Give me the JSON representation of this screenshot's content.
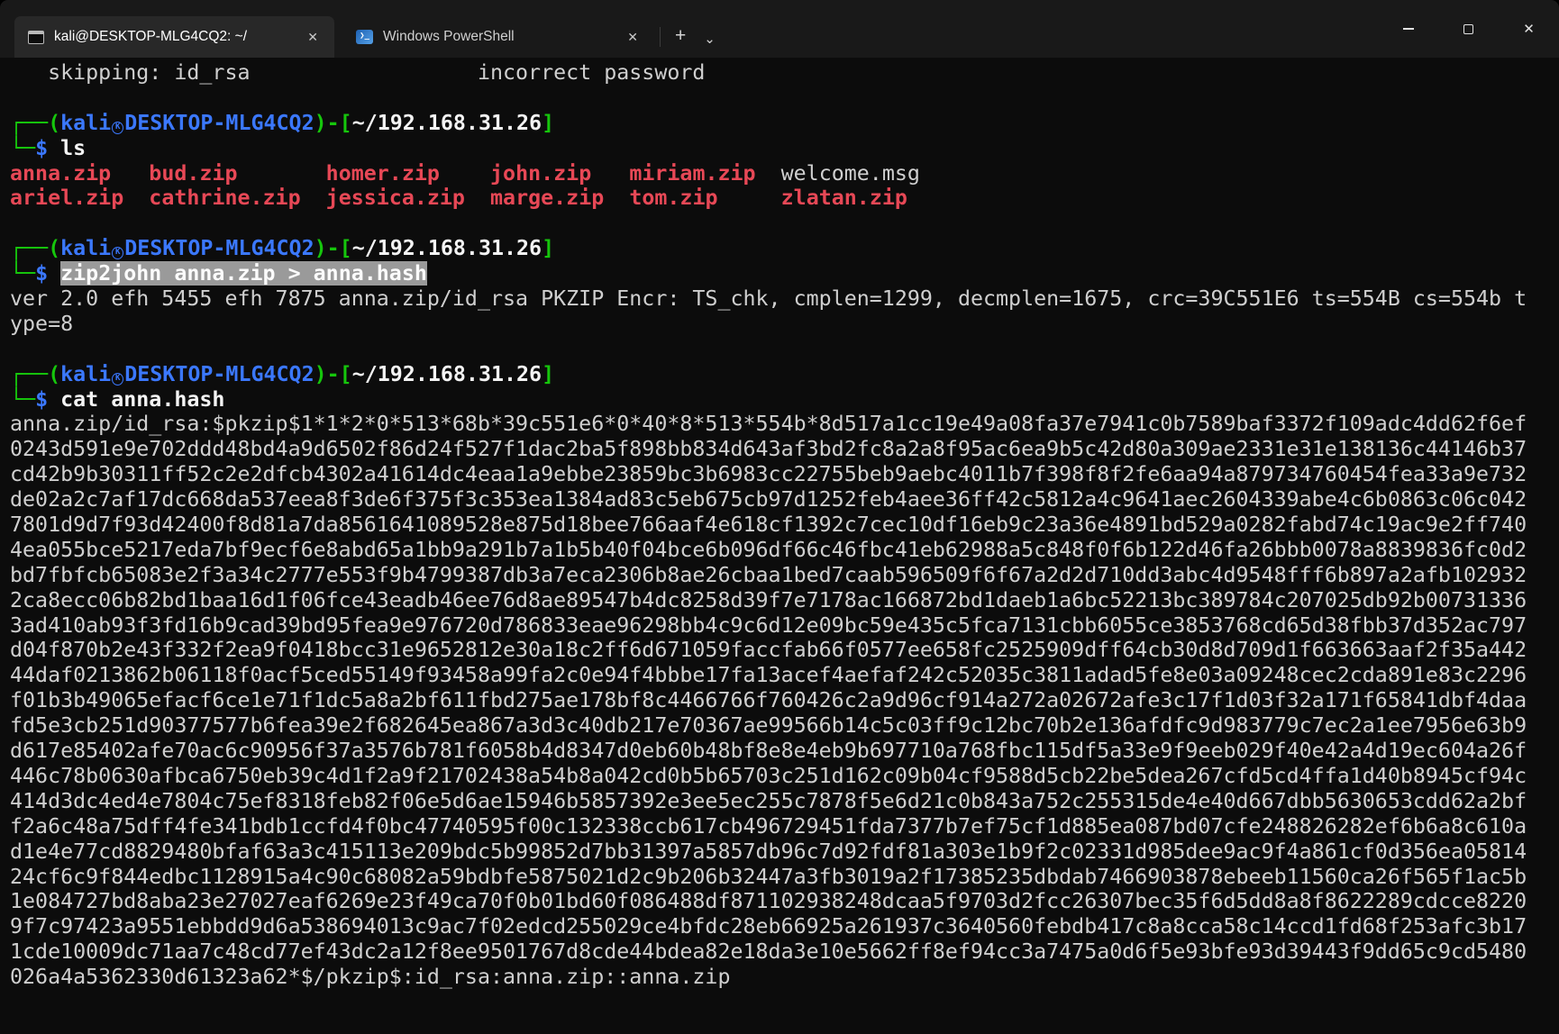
{
  "window": {
    "titlebar": {
      "tabs": [
        {
          "label": "kali@DESKTOP-MLG4CQ2: ~/",
          "icon": "terminal-icon",
          "active": true
        },
        {
          "label": "Windows PowerShell",
          "icon": "powershell-icon",
          "active": false
        }
      ],
      "icons": {
        "tab_close": "✕",
        "new_tab": "+",
        "dropdown": "⌄",
        "powershell_glyph": "❯_",
        "window_close": "✕"
      }
    }
  },
  "colors": {
    "terminal_background": "#0c0c0c",
    "titlebar_background": "#191919",
    "active_tab": "#282828",
    "foreground": "#cccccc",
    "prompt_green": "#16C60C",
    "prompt_blue": "#3B78FF",
    "file_red": "#E74856",
    "selection_background": "#9a9a9a"
  },
  "terminal": {
    "lines": [
      [
        {
          "t": "   skipping: id_rsa                  incorrect password",
          "c": "w"
        }
      ],
      [],
      [
        {
          "t": "┌──(",
          "c": "g"
        },
        {
          "t": "kali",
          "c": "b"
        },
        {
          "t": "㉿",
          "c": "kglyph"
        },
        {
          "t": "DESKTOP-MLG4CQ2",
          "c": "b"
        },
        {
          "t": ")-[",
          "c": "g"
        },
        {
          "t": "~/192.168.31.26",
          "c": "wb"
        },
        {
          "t": "]",
          "c": "g"
        }
      ],
      [
        {
          "t": "└─",
          "c": "g"
        },
        {
          "t": "$",
          "c": "b"
        },
        {
          "t": " ls",
          "c": "wb"
        }
      ],
      [
        {
          "t": "anna.zip",
          "c": "r"
        },
        {
          "t": "   ",
          "c": "w"
        },
        {
          "t": "bud.zip",
          "c": "r"
        },
        {
          "t": "       ",
          "c": "w"
        },
        {
          "t": "homer.zip",
          "c": "r"
        },
        {
          "t": "    ",
          "c": "w"
        },
        {
          "t": "john.zip",
          "c": "r"
        },
        {
          "t": "   ",
          "c": "w"
        },
        {
          "t": "miriam.zip",
          "c": "r"
        },
        {
          "t": "  welcome.msg",
          "c": "w"
        }
      ],
      [
        {
          "t": "ariel.zip",
          "c": "r"
        },
        {
          "t": "  ",
          "c": "w"
        },
        {
          "t": "cathrine.zip",
          "c": "r"
        },
        {
          "t": "  ",
          "c": "w"
        },
        {
          "t": "jessica.zip",
          "c": "r"
        },
        {
          "t": "  ",
          "c": "w"
        },
        {
          "t": "marge.zip",
          "c": "r"
        },
        {
          "t": "  ",
          "c": "w"
        },
        {
          "t": "tom.zip",
          "c": "r"
        },
        {
          "t": "     ",
          "c": "w"
        },
        {
          "t": "zlatan.zip",
          "c": "r"
        }
      ],
      [],
      [
        {
          "t": "┌──(",
          "c": "g"
        },
        {
          "t": "kali",
          "c": "b"
        },
        {
          "t": "㉿",
          "c": "kglyph"
        },
        {
          "t": "DESKTOP-MLG4CQ2",
          "c": "b"
        },
        {
          "t": ")-[",
          "c": "g"
        },
        {
          "t": "~/192.168.31.26",
          "c": "wb"
        },
        {
          "t": "]",
          "c": "g"
        }
      ],
      [
        {
          "t": "└─",
          "c": "g"
        },
        {
          "t": "$",
          "c": "b"
        },
        {
          "t": " ",
          "c": "w"
        },
        {
          "t": "zip2john anna.zip > anna.hash",
          "c": "sel"
        }
      ],
      [
        {
          "t": "ver 2.0 efh 5455 efh 7875 anna.zip/id_rsa PKZIP Encr: TS_chk, cmplen=1299, decmplen=1675, crc=39C551E6 ts=554B cs=554b t",
          "c": "w"
        }
      ],
      [
        {
          "t": "ype=8",
          "c": "w"
        }
      ],
      [],
      [
        {
          "t": "┌──(",
          "c": "g"
        },
        {
          "t": "kali",
          "c": "b"
        },
        {
          "t": "㉿",
          "c": "kglyph"
        },
        {
          "t": "DESKTOP-MLG4CQ2",
          "c": "b"
        },
        {
          "t": ")-[",
          "c": "g"
        },
        {
          "t": "~/192.168.31.26",
          "c": "wb"
        },
        {
          "t": "]",
          "c": "g"
        }
      ],
      [
        {
          "t": "└─",
          "c": "g"
        },
        {
          "t": "$",
          "c": "b"
        },
        {
          "t": " cat anna.hash",
          "c": "wb"
        }
      ],
      [
        {
          "t": "anna.zip/id_rsa:$pkzip$1*1*2*0*513*68b*39c551e6*0*40*8*513*554b*8d517a1cc19e49a08fa37e7941c0b7589baf3372f109adc4dd62f6ef",
          "c": "w"
        }
      ],
      [
        {
          "t": "0243d591e9e702ddd48bd4a9d6502f86d24f527f1dac2ba5f898bb834d643af3bd2fc8a2a8f95ac6ea9b5c42d80a309ae2331e31e138136c44146b37",
          "c": "w"
        }
      ],
      [
        {
          "t": "cd42b9b30311ff52c2e2dfcb4302a41614dc4eaa1a9ebbe23859bc3b6983cc22755beb9aebc4011b7f398f8f2fe6aa94a879734760454fea33a9e732",
          "c": "w"
        }
      ],
      [
        {
          "t": "de02a2c7af17dc668da537eea8f3de6f375f3c353ea1384ad83c5eb675cb97d1252feb4aee36ff42c5812a4c9641aec2604339abe4c6b0863c06c042",
          "c": "w"
        }
      ],
      [
        {
          "t": "7801d9d7f93d42400f8d81a7da8561641089528e875d18bee766aaf4e618cf1392c7cec10df16eb9c23a36e4891bd529a0282fabd74c19ac9e2ff740",
          "c": "w"
        }
      ],
      [
        {
          "t": "4ea055bce5217eda7bf9ecf6e8abd65a1bb9a291b7a1b5b40f04bce6b096df66c46fbc41eb62988a5c848f0f6b122d46fa26bbb0078a8839836fc0d2",
          "c": "w"
        }
      ],
      [
        {
          "t": "bd7fbfcb65083e2f3a34c2777e553f9b4799387db3a7eca2306b8ae26cbaa1bed7caab596509f6f67a2d2d710dd3abc4d9548fff6b897a2afb102932",
          "c": "w"
        }
      ],
      [
        {
          "t": "2ca8ecc06b82bd1baa16d1f06fce43eadb46ee76d8ae89547b4dc8258d39f7e7178ac166872bd1daeb1a6bc52213bc389784c207025db92b00731336",
          "c": "w"
        }
      ],
      [
        {
          "t": "3ad410ab93f3fd16b9cad39bd95fea9e976720d786833eae96298bb4c9c6d12e09bc59e435c5fca7131cbb6055ce3853768cd65d38fbb37d352ac797",
          "c": "w"
        }
      ],
      [
        {
          "t": "d04f870b2e43f332f2ea9f0418bcc31e9652812e30a18c2ff6d671059faccfab66f0577ee658fc2525909dff64cb30d8d709d1f663663aaf2f35a442",
          "c": "w"
        }
      ],
      [
        {
          "t": "44daf0213862b06118f0acf5ced55149f93458a99fa2c0e94f4bbbe17fa13acef4aefaf242c52035c3811adad5fe8e03a09248cec2cda891e83c2296",
          "c": "w"
        }
      ],
      [
        {
          "t": "f01b3b49065efacf6ce1e71f1dc5a8a2bf611fbd275ae178bf8c4466766f760426c2a9d96cf914a272a02672afe3c17f1d03f32a171f65841dbf4daa",
          "c": "w"
        }
      ],
      [
        {
          "t": "fd5e3cb251d90377577b6fea39e2f682645ea867a3d3c40db217e70367ae99566b14c5c03ff9c12bc70b2e136afdfc9d983779c7ec2a1ee7956e63b9",
          "c": "w"
        }
      ],
      [
        {
          "t": "d617e85402afe70ac6c90956f37a3576b781f6058b4d8347d0eb60b48bf8e8e4eb9b697710a768fbc115df5a33e9f9eeb029f40e42a4d19ec604a26f",
          "c": "w"
        }
      ],
      [
        {
          "t": "446c78b0630afbca6750eb39c4d1f2a9f21702438a54b8a042cd0b5b65703c251d162c09b04cf9588d5cb22be5dea267cfd5cd4ffa1d40b8945cf94c",
          "c": "w"
        }
      ],
      [
        {
          "t": "414d3dc4ed4e7804c75ef8318feb82f06e5d6ae15946b5857392e3ee5ec255c7878f5e6d21c0b843a752c255315de4e40d667dbb5630653cdd62a2bf",
          "c": "w"
        }
      ],
      [
        {
          "t": "f2a6c48a75dff4fe341bdb1ccfd4f0bc47740595f00c132338ccb617cb496729451fda7377b7ef75cf1d885ea087bd07cfe248826282ef6b6a8c610a",
          "c": "w"
        }
      ],
      [
        {
          "t": "d1e4e77cd8829480bfaf63a3c415113e209bdc5b99852d7bb31397a5857db96c7d92fdf81a303e1b9f2c02331d985dee9ac9f4a861cf0d356ea05814",
          "c": "w"
        }
      ],
      [
        {
          "t": "24cf6c9f844edbc1128915a4c90c68082a59bdbfe5875021d2c9b206b32447a3fb3019a2f17385235dbdab7466903878ebeeb11560ca26f565f1ac5b",
          "c": "w"
        }
      ],
      [
        {
          "t": "1e084727bd8aba23e27027eaf6269e23f49ca70f0b01bd60f086488df871102938248dcaa5f9703d2fcc26307bec35f6d5dd8a8f8622289cdcce8220",
          "c": "w"
        }
      ],
      [
        {
          "t": "9f7c97423a9551ebbdd9d6a538694013c9ac7f02edcd255029ce4bfdc28eb66925a261937c3640560febdb417c8a8cca58c14ccd1fd68f253afc3b17",
          "c": "w"
        }
      ],
      [
        {
          "t": "1cde10009dc71aa7c48cd77ef43dc2a12f8ee9501767d8cde44bdea82e18da3e10e5662ff8ef94cc3a7475a0d6f5e93bfe93d39443f9dd65c9cd5480",
          "c": "w"
        }
      ],
      [
        {
          "t": "026a4a5362330d61323a62*$/pkzip$:id_rsa:anna.zip::anna.zip",
          "c": "w"
        }
      ]
    ]
  }
}
